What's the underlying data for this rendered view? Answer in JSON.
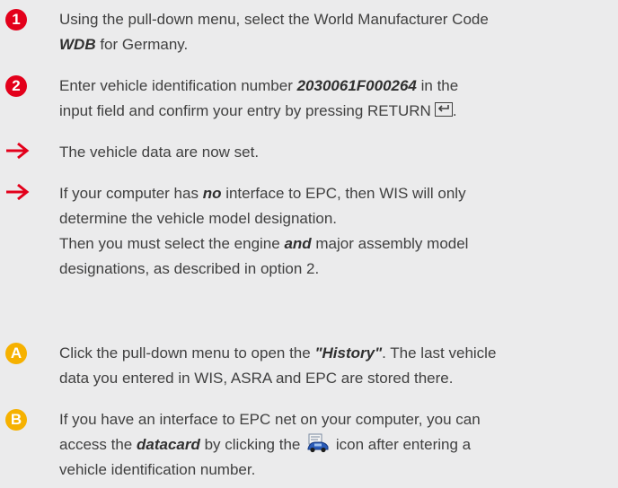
{
  "steps": [
    {
      "marker": "1",
      "lines": [
        {
          "pre": "Using the pull-down menu, select the World Manufacturer Code"
        },
        {
          "bold": "WDB",
          "post": " for Germany."
        }
      ]
    },
    {
      "marker": "2",
      "line1": {
        "pre": "Enter vehicle identification number ",
        "bold": "2030061F000264",
        "post": " in the"
      },
      "line2": {
        "pre": "input field and confirm your entry by pressing RETURN",
        "post": "."
      }
    }
  ],
  "results": [
    {
      "text": "The vehicle data are now set."
    },
    {
      "line1": {
        "pre": "If your computer has ",
        "bold": "no",
        "post": " interface to EPC, then WIS will only"
      },
      "line2": "determine the vehicle model designation.",
      "line3": {
        "pre": "Then you must select the engine ",
        "bold": "and",
        "post": " major assembly model"
      },
      "line4": "designations, as described in option 2."
    }
  ],
  "notes": [
    {
      "marker": "A",
      "line1": {
        "pre": "Click the pull-down menu to open the ",
        "bold": "\"History\"",
        "post": ". The last vehicle"
      },
      "line2": "data you entered in WIS, ASRA and EPC are stored there."
    },
    {
      "marker": "B",
      "line1": "If you have an interface to EPC net on your computer, you can",
      "line2": {
        "pre": "access the ",
        "bold": "datacard",
        "mid": " by clicking the ",
        "post": " icon after entering a"
      },
      "line3": "vehicle identification number."
    }
  ],
  "colors": {
    "number_marker": "#e3001b",
    "letter_marker": "#f6b100",
    "arrow": "#e3001b",
    "background": "#ebebec"
  },
  "icons": {
    "arrow": "right-arrow-icon",
    "return": "return-key-icon",
    "datacard": "datacard-car-icon"
  }
}
